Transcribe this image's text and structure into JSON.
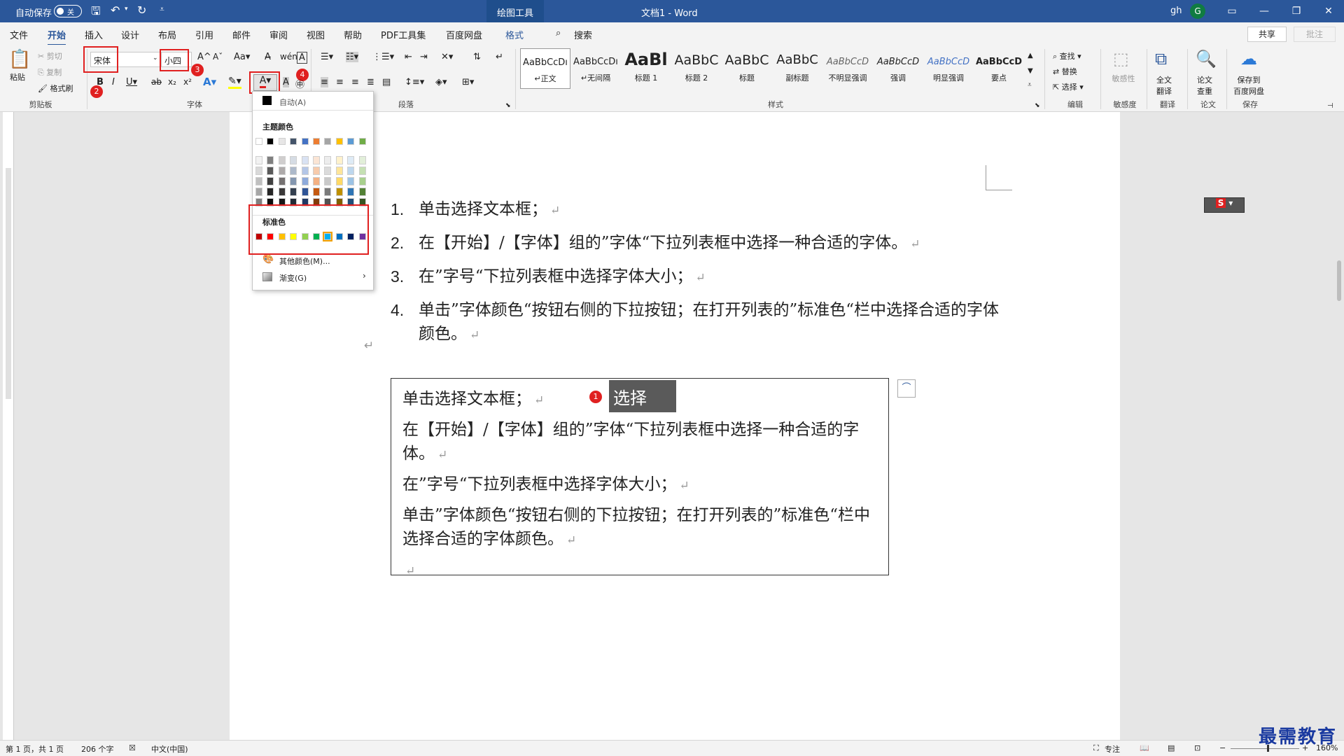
{
  "titlebar": {
    "autosave_label": "自动保存",
    "autosave_state": "关",
    "context_tab": "绘图工具",
    "doc_title": "文档1  -  Word",
    "user": "gh",
    "avatar_letter": "G"
  },
  "menubar": {
    "tabs": [
      "文件",
      "开始",
      "插入",
      "设计",
      "布局",
      "引用",
      "邮件",
      "审阅",
      "视图",
      "帮助",
      "PDF工具集",
      "百度网盘",
      "格式"
    ],
    "search": "搜索",
    "share": "共享",
    "notes": "批注"
  },
  "ribbon": {
    "clipboard": {
      "paste": "粘贴",
      "cut": "剪切",
      "copy": "复制",
      "format_painter": "格式刷",
      "group": "剪贴板"
    },
    "font": {
      "font_name": "宋体",
      "font_size": "小四",
      "group": "字体"
    },
    "paragraph": {
      "group": "段落"
    },
    "styles": {
      "group": "样式",
      "items": [
        {
          "preview": "AaBbCcDı",
          "name": "↵正文"
        },
        {
          "preview": "AaBbCcDı",
          "name": "↵无间隔"
        },
        {
          "preview": "AaBl",
          "name": "标题 1"
        },
        {
          "preview": "AaBbC",
          "name": "标题 2"
        },
        {
          "preview": "AaBbC",
          "name": "标题"
        },
        {
          "preview": "AaBbC",
          "name": "副标题"
        },
        {
          "preview": "AaBbCcD",
          "name": "不明显强调"
        },
        {
          "preview": "AaBbCcD",
          "name": "强调"
        },
        {
          "preview": "AaBbCcD",
          "name": "明显强调"
        },
        {
          "preview": "AaBbCcD",
          "name": "要点"
        }
      ]
    },
    "editing": {
      "find": "查找",
      "replace": "替换",
      "select": "选择",
      "group": "编辑"
    },
    "sensitivity": {
      "label": "敏感性",
      "group": "敏感度"
    },
    "translate": {
      "label1": "全文",
      "label2": "翻译",
      "group": "翻译"
    },
    "paper": {
      "label1": "论文",
      "label2": "查重",
      "group": "论文"
    },
    "save": {
      "label1": "保存到",
      "label2": "百度网盘",
      "group": "保存"
    }
  },
  "annotations": [
    "1",
    "2",
    "3",
    "4"
  ],
  "font_color_menu": {
    "auto": "自动(A)",
    "theme_title": "主题颜色",
    "standard_title": "标准色",
    "more_colors": "其他颜色(M)...",
    "gradient": "渐变(G)",
    "theme_top": [
      "#ffffff",
      "#000000",
      "#e7e6e6",
      "#44546a",
      "#4472c4",
      "#ed7d31",
      "#a5a5a5",
      "#ffc000",
      "#5b9bd5",
      "#70ad47"
    ],
    "theme_cols": [
      [
        "#f2f2f2",
        "#d9d9d9",
        "#bfbfbf",
        "#a6a6a6",
        "#808080"
      ],
      [
        "#7f7f7f",
        "#595959",
        "#404040",
        "#262626",
        "#0d0d0d"
      ],
      [
        "#d0cece",
        "#aeaaaa",
        "#757171",
        "#3a3838",
        "#171616"
      ],
      [
        "#d6dce4",
        "#adb9ca",
        "#8497b0",
        "#333f4f",
        "#222a35"
      ],
      [
        "#d9e2f3",
        "#b4c6e7",
        "#8eaadb",
        "#2f5496",
        "#1f3864"
      ],
      [
        "#fbe5d5",
        "#f7cbac",
        "#f4b183",
        "#c55a11",
        "#833c0b"
      ],
      [
        "#ededed",
        "#dbdbdb",
        "#c9c9c9",
        "#7b7b7b",
        "#525252"
      ],
      [
        "#fff2cc",
        "#fee599",
        "#ffd965",
        "#bf9000",
        "#7f6000"
      ],
      [
        "#deebf6",
        "#bdd7ee",
        "#9cc3e5",
        "#2e75b5",
        "#1f4e79"
      ],
      [
        "#e2efd9",
        "#c5e0b3",
        "#a8d08d",
        "#538135",
        "#375623"
      ]
    ],
    "standard": [
      "#c00000",
      "#ff0000",
      "#ffc000",
      "#ffff00",
      "#92d050",
      "#00b050",
      "#00b0f0",
      "#0070c0",
      "#002060",
      "#7030a0"
    ]
  },
  "document": {
    "list": [
      {
        "num": "1.",
        "text": "单击选择文本框；"
      },
      {
        "num": "2.",
        "text": "在【开始】/【字体】组的”字体“下拉列表框中选择一种合适的字体。"
      },
      {
        "num": "3.",
        "text": "在”字号“下拉列表框中选择字体大小；"
      },
      {
        "num": "4.",
        "text": "单击”字体颜色“按钮右侧的下拉按钮；在打开列表的”标准色“栏中选择合适的字体颜色。"
      }
    ],
    "textbox": [
      "单击选择文本框；",
      "在【开始】/【字体】组的”字体“下拉列表框中选择一种合适的字体。",
      "在”字号“下拉列表框中选择字体大小；",
      "单击”字体颜色“按钮右侧的下拉按钮；在打开列表的”标准色“栏中选择合适的字体颜色。"
    ],
    "paragraph_mark": "↵",
    "tooltip": "选择"
  },
  "statusbar": {
    "page": "第 1 页，共 1 页",
    "words": "206 个字",
    "language": "中文(中国)",
    "focus": "专注",
    "zoom": "160%"
  },
  "watermark": "最需教育"
}
